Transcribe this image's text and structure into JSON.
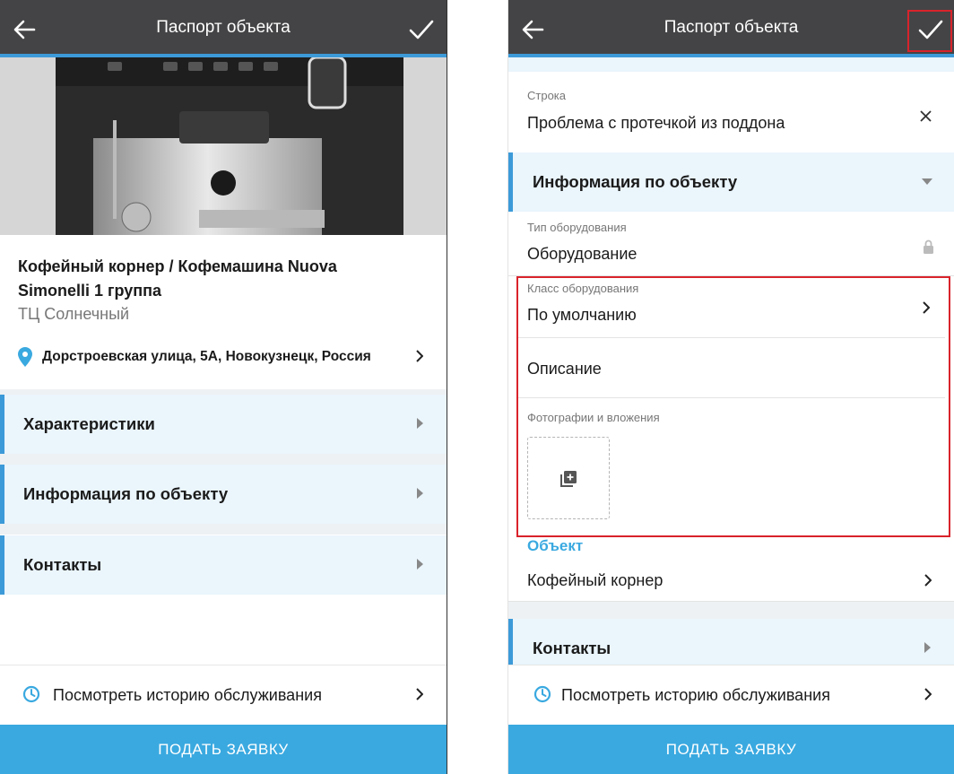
{
  "left": {
    "appbar": {
      "title": "Паспорт объекта"
    },
    "object": {
      "title": "Кофейный корнер / Кофемашина Nuova Simonelli 1 группа",
      "location": "ТЦ Солнечный",
      "address": "Дорстроевская улица, 5А, Новокузнецк, Россия"
    },
    "sections": [
      {
        "label": "Характеристики"
      },
      {
        "label": "Информация по объекту"
      },
      {
        "label": "Контакты"
      }
    ],
    "history": "Посмотреть историю обслуживания",
    "submit": "ПОДАТЬ ЗАЯВКУ"
  },
  "right": {
    "appbar": {
      "title": "Паспорт объекта"
    },
    "row_field": {
      "label": "Строка",
      "value": "Проблема с протечкой из поддона"
    },
    "section_info": "Информация по объекту",
    "equipment_type": {
      "label": "Тип оборудования",
      "value": "Оборудование"
    },
    "equipment_class": {
      "label": "Класс оборудования",
      "value": "По умолчанию"
    },
    "description": "Описание",
    "attachments_label": "Фотографии и вложения",
    "object_heading": "Объект",
    "object_value": "Кофейный корнер",
    "section_contacts": "Контакты",
    "history": "Посмотреть историю обслуживания",
    "submit": "ПОДАТЬ ЗАЯВКУ"
  },
  "colors": {
    "appbar": "#444446",
    "accent": "#3c9ad8",
    "button": "#3aa9e0",
    "highlight": "#d9232b",
    "section_bg": "#eaf5fc"
  },
  "icons": [
    "back-arrow-icon",
    "check-icon",
    "location-pin-icon",
    "chevron-right-icon",
    "clock-icon",
    "close-icon",
    "lock-icon",
    "add-photo-icon"
  ]
}
